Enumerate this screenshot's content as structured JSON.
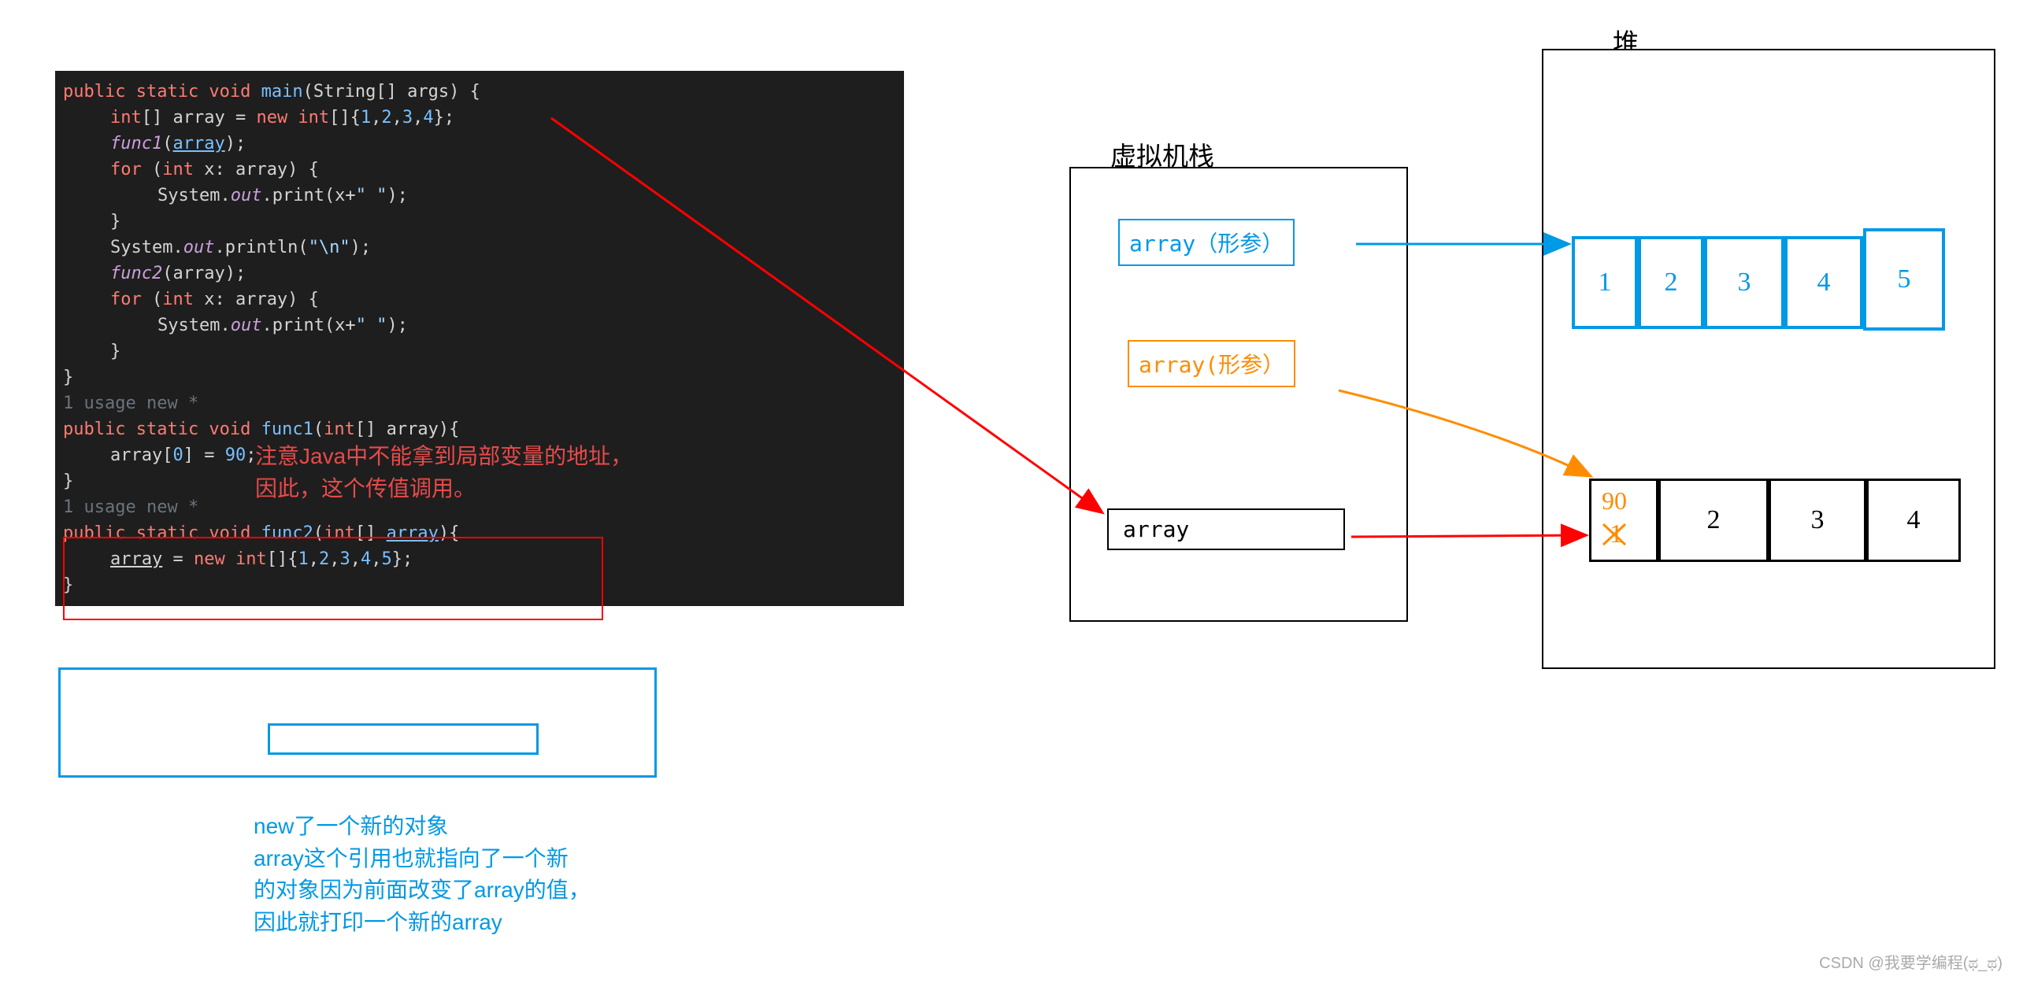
{
  "code": {
    "l1_a": "public static void ",
    "l1_b": "main",
    "l1_c": "(String[] args) {",
    "l2_a": "int",
    "l2_b": "[] array = ",
    "l2_c": "new int",
    "l2_d": "[]{",
    "l2_n1": "1",
    "l2_c1": ",",
    "l2_n2": "2",
    "l2_c2": ",",
    "l2_n3": "3",
    "l2_c3": ",",
    "l2_n4": "4",
    "l2_e": "};",
    "l3_a": "func1",
    "l3_b": "(",
    "l3_c": "array",
    "l3_d": ");",
    "l4_a": "for ",
    "l4_b": "(",
    "l4_c": "int ",
    "l4_d": "x: array) {",
    "l5_a": "System.",
    "l5_b": "out",
    "l5_c": ".print(x+",
    "l5_d": "\" \"",
    "l5_e": ");",
    "l6": "}",
    "l7_a": "System.",
    "l7_b": "out",
    "l7_c": ".println(",
    "l7_d": "\"\\n\"",
    "l7_e": ");",
    "l8_a": "func2",
    "l8_b": "(array);",
    "l9_a": "for ",
    "l9_b": "(",
    "l9_c": "int ",
    "l9_d": "x: array) {",
    "l10_a": "System.",
    "l10_b": "out",
    "l10_c": ".print(x+",
    "l10_d": "\" \"",
    "l10_e": ");",
    "l11": "}",
    "l12": "}",
    "l13": "1 usage   new *",
    "l14_a": "public static void ",
    "l14_b": "func1",
    "l14_c": "(",
    "l14_d": "int",
    "l14_e": "[] array){",
    "l15_a": "array[",
    "l15_b": "0",
    "l15_c": "] = ",
    "l15_d": "90",
    "l15_e": ";",
    "l16": "}",
    "l17": "1 usage   new *",
    "l18_a": "public static void ",
    "l18_b": "func2",
    "l18_c": "(",
    "l18_d": "int",
    "l18_e": "[] ",
    "l18_f": "array",
    "l18_g": "){",
    "l19_a": "array",
    "l19_b": " = ",
    "l19_c": "new int",
    "l19_d": "[]{",
    "l19_n1": "1",
    "l19_c1": ",",
    "l19_n2": "2",
    "l19_c2": ",",
    "l19_n3": "3",
    "l19_c3": ",",
    "l19_n4": "4",
    "l19_c4": ",",
    "l19_n5": "5",
    "l19_e": "};",
    "l20": "}"
  },
  "anno": {
    "red1": "注意Java中不能拿到局部变量的地址，",
    "red2": "因此，这个传值调用。",
    "blue1": "new了一个新的对象",
    "blue2": "array这个引用也就指向了一个新",
    "blue3": "的对象因为前面改变了array的值，",
    "blue4": "因此就打印一个新的array"
  },
  "labels": {
    "heap": "堆",
    "stack": "虚拟机栈",
    "param_blue": "array（形参）",
    "param_orange": "array(形参）",
    "param_black": "array"
  },
  "heap_blue": [
    "1",
    "2",
    "3",
    "4",
    "5"
  ],
  "heap_black": [
    "1",
    "2",
    "3",
    "4"
  ],
  "heap_90": "90",
  "watermark": "CSDN @我要学编程(ಥ_ಥ)"
}
